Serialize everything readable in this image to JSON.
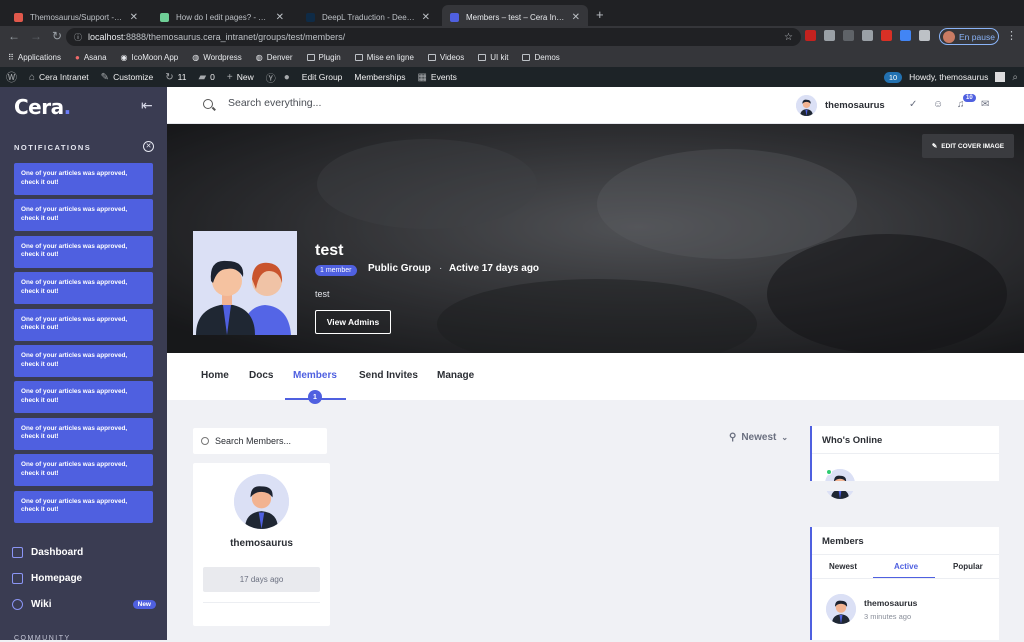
{
  "browser": {
    "tabs": [
      {
        "title": "Themosaurus/Support - How d",
        "fav": "#e0584b"
      },
      {
        "title": "How do I edit pages? - Themo",
        "fav": "#6fcf97"
      },
      {
        "title": "DeepL Traduction - DeepL Trad",
        "fav": "#0f2b46"
      },
      {
        "title": "Members – test – Cera Intranet",
        "fav": "#4f60e0"
      }
    ],
    "url_host": "localhost",
    "url_rest": ":8888/themosaurus.cera_intranet/groups/test/members/",
    "pause_label": "En pause",
    "bookmarks": [
      "Applications",
      "Asana",
      "IcoMoon App",
      "Wordpress",
      "Denver",
      "Plugin",
      "Mise en ligne",
      "Videos",
      "UI kit",
      "Demos"
    ]
  },
  "wpbar": {
    "site": "Cera Intranet",
    "customize": "Customize",
    "updates": "11",
    "comments": "0",
    "new": "New",
    "edit_group": "Edit Group",
    "memberships": "Memberships",
    "events": "Events",
    "badge": "10",
    "howdy": "Howdy, themosaurus"
  },
  "sidebar": {
    "logo": "Cera",
    "notifications_title": "NOTIFICATIONS",
    "notifications": [
      "One of your articles was approved, check it out!",
      "One of your articles was approved, check it out!",
      "One of your articles was approved, check it out!",
      "One of your articles was approved, check it out!",
      "One of your articles was approved, check it out!",
      "One of your articles was approved, check it out!",
      "One of your articles was approved, check it out!",
      "One of your articles was approved, check it out!",
      "One of your articles was approved, check it out!",
      "One of your articles was approved, check it out!"
    ],
    "nav": [
      {
        "label": "Dashboard",
        "badge": ""
      },
      {
        "label": "Homepage",
        "badge": ""
      },
      {
        "label": "Wiki",
        "badge": "New"
      }
    ],
    "community": "COMMUNITY"
  },
  "header": {
    "search_placeholder": "Search everything...",
    "username": "themosaurus",
    "notif_count": "10"
  },
  "group": {
    "edit_cover": "EDIT COVER IMAGE",
    "name": "test",
    "member_count": "1 member",
    "type": "Public Group",
    "active": "Active 17 days ago",
    "description": "test",
    "view_admins": "View Admins",
    "tabs": [
      "Home",
      "Docs",
      "Members",
      "Send Invites",
      "Manage"
    ],
    "active_tab_count": "1"
  },
  "members": {
    "search_placeholder": "Search Members...",
    "sort": "Newest",
    "cards": [
      {
        "name": "themosaurus",
        "time": "17 days ago"
      }
    ]
  },
  "widgets": {
    "online_title": "Who's Online",
    "members_title": "Members",
    "member_tabs": [
      "Newest",
      "Active",
      "Popular"
    ],
    "member_list": [
      {
        "name": "themosaurus",
        "time": "3 minutes ago"
      }
    ]
  }
}
